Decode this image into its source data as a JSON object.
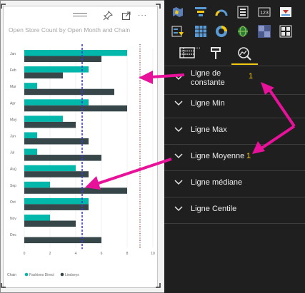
{
  "chart": {
    "title": "Open Store Count by Open Month and Chain",
    "legend_prefix": "Chain",
    "chart_data": {
      "type": "bar",
      "orientation": "horizontal",
      "title": "Open Store Count by Open Month and Chain",
      "categories": [
        "Jan",
        "Feb",
        "Mar",
        "Apr",
        "May",
        "Jun",
        "Jul",
        "Aug",
        "Sep",
        "Oct",
        "Nov",
        "Dec"
      ],
      "series": [
        {
          "name": "Fashions Direct",
          "color": "#01b8aa",
          "values": [
            8,
            5,
            1,
            5,
            3,
            1,
            1,
            4,
            2,
            5,
            2,
            0
          ]
        },
        {
          "name": "Lindseys",
          "color": "#374649",
          "values": [
            6,
            3,
            7,
            8,
            4,
            5,
            6,
            5,
            8,
            5,
            4,
            6
          ]
        }
      ],
      "xticks": [
        "0",
        "2",
        "4",
        "6",
        "8",
        "10"
      ],
      "xlim": [
        0,
        10
      ],
      "reference_lines": [
        {
          "kind": "average",
          "value": 4.5,
          "color": "#3b3bd6",
          "style": "dashed"
        },
        {
          "kind": "constant",
          "value": 9,
          "color": "#8b2d2d",
          "style": "dotted"
        }
      ],
      "grid": true,
      "legend_position": "bottom-left"
    }
  },
  "analytics_pane": {
    "rows": [
      {
        "label": "Ligne de constante",
        "count": "1"
      },
      {
        "label": "Ligne Min",
        "count": ""
      },
      {
        "label": "Ligne Max",
        "count": ""
      },
      {
        "label": "Ligne Moyenne",
        "count": "1"
      },
      {
        "label": "Ligne médiane",
        "count": ""
      },
      {
        "label": "Ligne Centile",
        "count": ""
      }
    ],
    "more_label": "...",
    "accent_color": "#f2c811"
  }
}
